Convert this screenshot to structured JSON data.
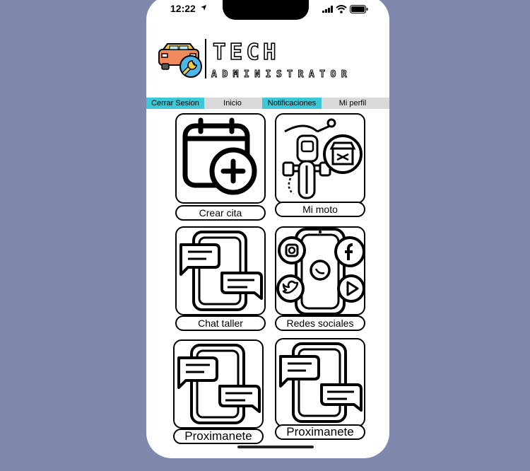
{
  "status_bar": {
    "time": "12:22"
  },
  "header": {
    "title": "TECH",
    "subtitle": "ADMINISTRATOR",
    "logo": "car-wrench-logo"
  },
  "nav": {
    "items": [
      {
        "label": "Cerrar Sesion",
        "active": true
      },
      {
        "label": "Inicio",
        "active": false
      },
      {
        "label": "Notificaciones",
        "active": true
      },
      {
        "label": "Mi perfil",
        "active": false
      }
    ]
  },
  "tiles": [
    {
      "label": "Crear cita",
      "icon": "calendar-add-icon"
    },
    {
      "label": "Mi moto",
      "icon": "motorcycle-shop-icon"
    },
    {
      "label": "Chat taller",
      "icon": "phone-chat-icon"
    },
    {
      "label": "Redes sociales",
      "icon": "social-media-phone-icon"
    },
    {
      "label": "Proximanete",
      "icon": "phone-chat-icon"
    },
    {
      "label": "Proximanete",
      "icon": "phone-chat-icon"
    }
  ],
  "colors": {
    "accent": "#3cc8d6",
    "background": "#7f89ad",
    "nav_bg": "#d9d9d9"
  }
}
